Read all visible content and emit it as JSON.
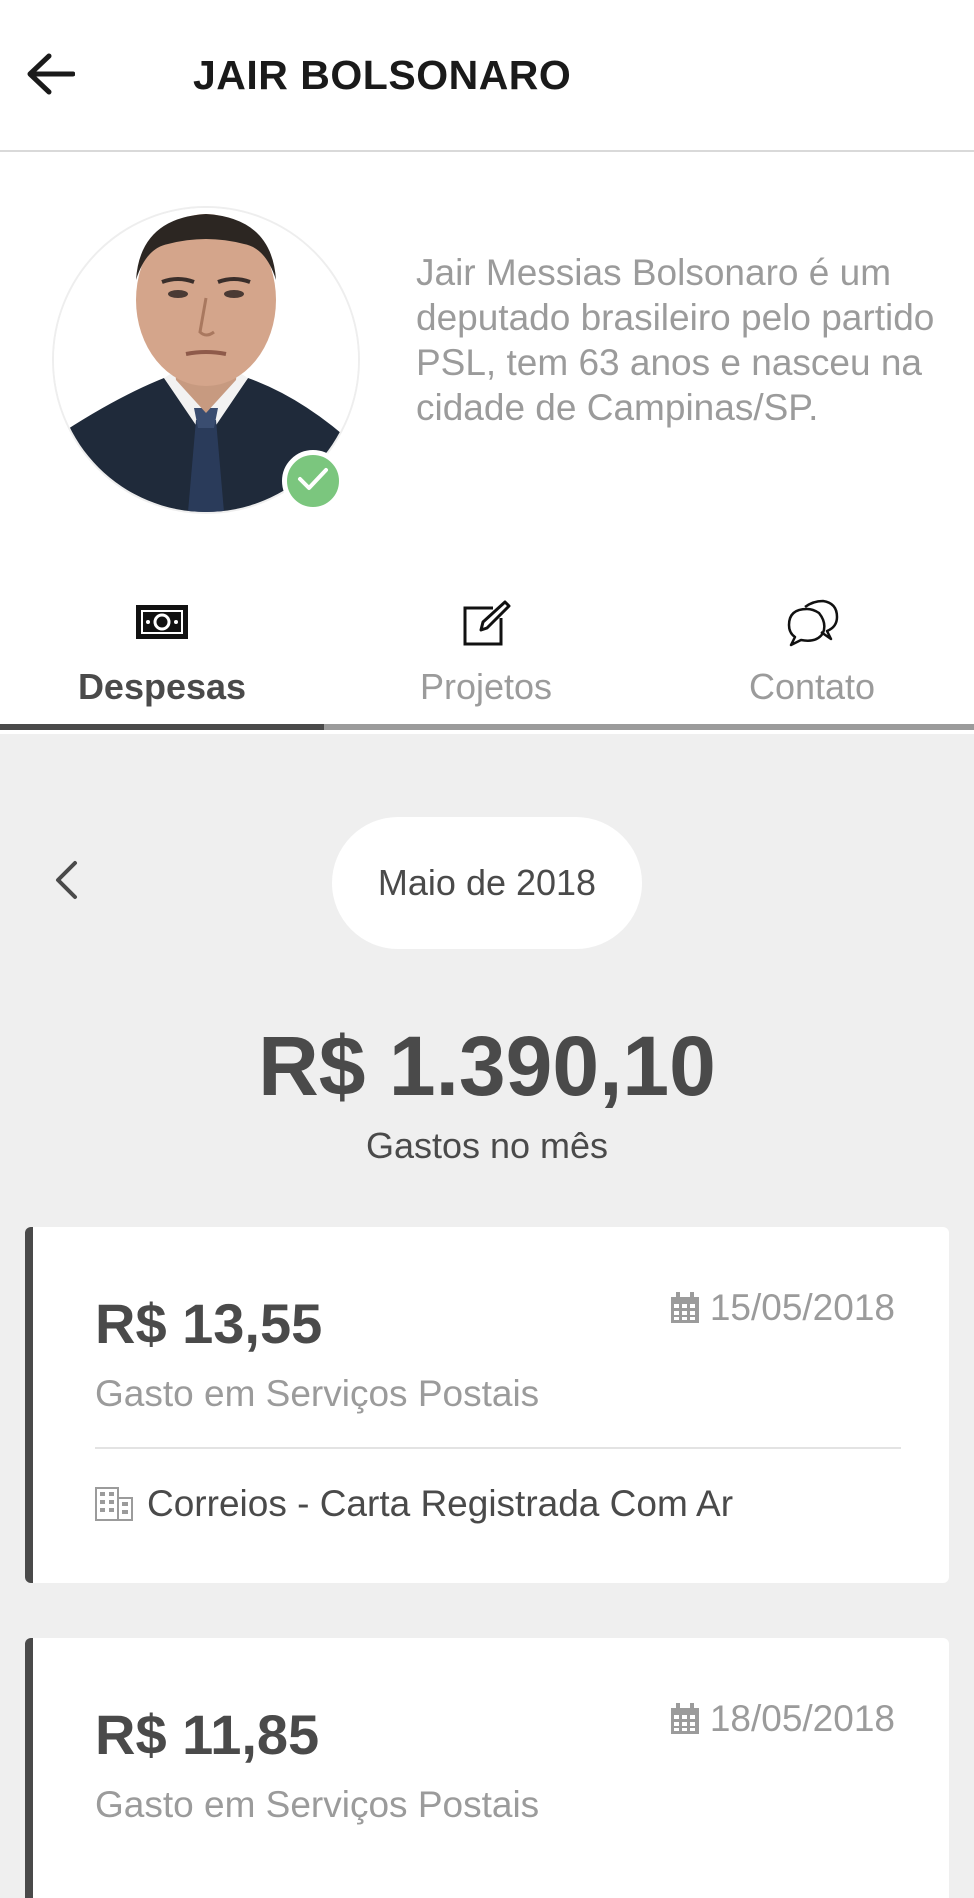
{
  "header": {
    "title": "JAIR BOLSONARO",
    "back_icon": "arrow-left-icon"
  },
  "profile": {
    "bio": "Jair Messias Bolsonaro é um deputado brasileiro pelo partido PSL, tem 63 anos e nasceu na cidade de Campinas/SP.",
    "verified": true,
    "verified_color": "#7bc67e"
  },
  "tabs": [
    {
      "label": "Despesas",
      "icon": "money-bill-icon",
      "active": true
    },
    {
      "label": "Projetos",
      "icon": "edit-icon",
      "active": false
    },
    {
      "label": "Contato",
      "icon": "chat-bubbles-icon",
      "active": false
    }
  ],
  "period": {
    "month": "Maio de 2018",
    "prev_icon": "chevron-left-icon"
  },
  "summary": {
    "total": "R$ 1.390,10",
    "caption": "Gastos no mês"
  },
  "expenses": [
    {
      "amount": "R$ 13,55",
      "date": "15/05/2018",
      "category": "Gasto em Serviços Postais",
      "supplier": "Correios - Carta Registrada Com Ar"
    },
    {
      "amount": "R$ 11,85",
      "date": "18/05/2018",
      "category": "Gasto em Serviços Postais"
    }
  ],
  "colors": {
    "background": "#efefef",
    "text_dark": "#4a4a4a",
    "text_muted": "#9b9b9b",
    "accent_verified": "#7bc67e"
  }
}
